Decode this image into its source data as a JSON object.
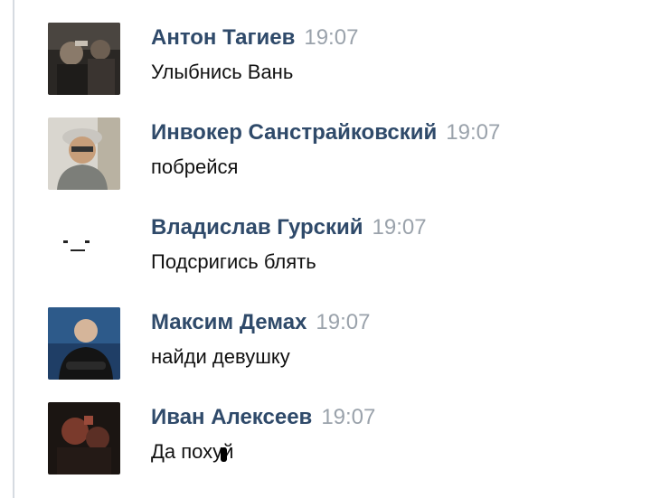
{
  "messages": [
    {
      "author": "Антон Тагиев",
      "time": "19:07",
      "text": "Улыбнись Вань",
      "avatar": "avatar-photo-dark"
    },
    {
      "author": "Инвокер Санстрайковский",
      "time": "19:07",
      "text": "побрейся",
      "avatar": "avatar-photo-man-in-cap"
    },
    {
      "author": "Владислав Гурский",
      "time": "19:07",
      "text": "Подсригись блять",
      "avatar": "avatar-face-emoticon"
    },
    {
      "author": "Максим Демах",
      "time": "19:07",
      "text": "найди девушку",
      "avatar": "avatar-photo-man-crossed-arms"
    },
    {
      "author": "Иван Алексеев",
      "time": "19:07",
      "text": "Да похуй",
      "avatar": "avatar-photo-dark-red"
    }
  ],
  "colors": {
    "author": "#2f4a6a",
    "time": "#9aa2ab",
    "text": "#111111",
    "border": "#d6dbe1"
  }
}
